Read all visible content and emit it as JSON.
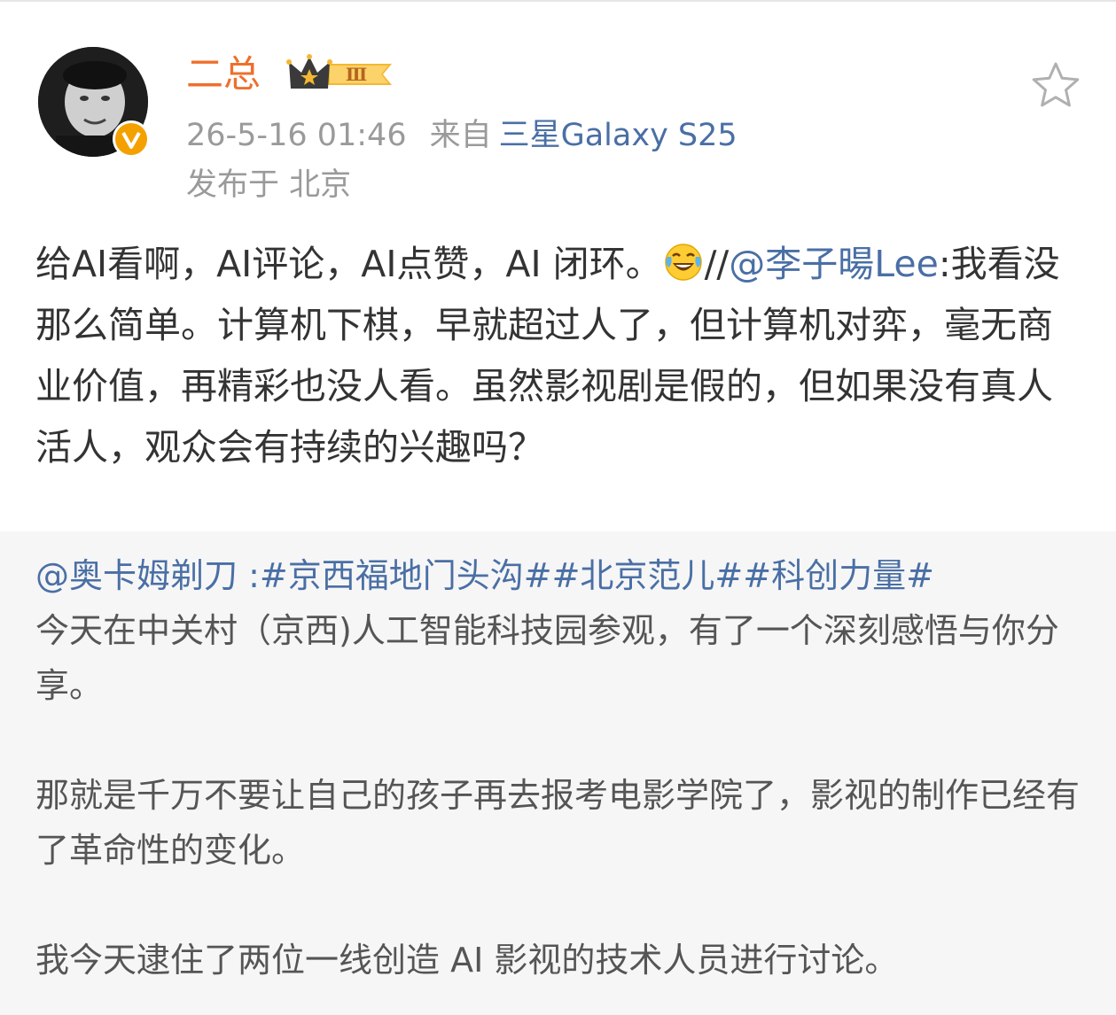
{
  "user": {
    "name": "二总",
    "level_badge": "Ⅲ",
    "verified_icon": "v-verified-badge"
  },
  "meta": {
    "time": "26-5-16 01:46",
    "source_label": "来自",
    "device": "三星Galaxy S25",
    "location": "发布于 北京"
  },
  "post": {
    "text_1": "给AI看啊，AI评论，AI点赞，AI 闭环。",
    "emoji": "laughing-tears-emoji",
    "text_2": "//",
    "mention": "@李子暘Lee",
    "text_3": ":我看没那么简单。计算机下棋，早就超过人了，但计算机对弈，毫无商业价值，再精彩也没人看。虽然影视剧是假的，但如果没有真人活人，观众会有持续的兴趣吗？"
  },
  "repost": {
    "author": "@奥卡姆剃刀",
    "sep": " :",
    "tags": [
      "#京西福地门头沟#",
      "#北京范儿#",
      "#科创力量#"
    ],
    "p1": "今天在中关村（京西)人工智能科技园参观，有了一个深刻感悟与你分享。",
    "p2": "那就是千万不要让自己的孩子再去报考电影学院了，影视的制作已经有了革命性的变化。",
    "p3": "我今天逮住了两位一线创造 AI 影视的技术人员进行讨论。"
  },
  "colors": {
    "username": "#ee6f2d",
    "link": "#4a6fa5",
    "meta": "#9a9a9a",
    "body": "#333333",
    "repost_bg": "#f6f6f6"
  }
}
